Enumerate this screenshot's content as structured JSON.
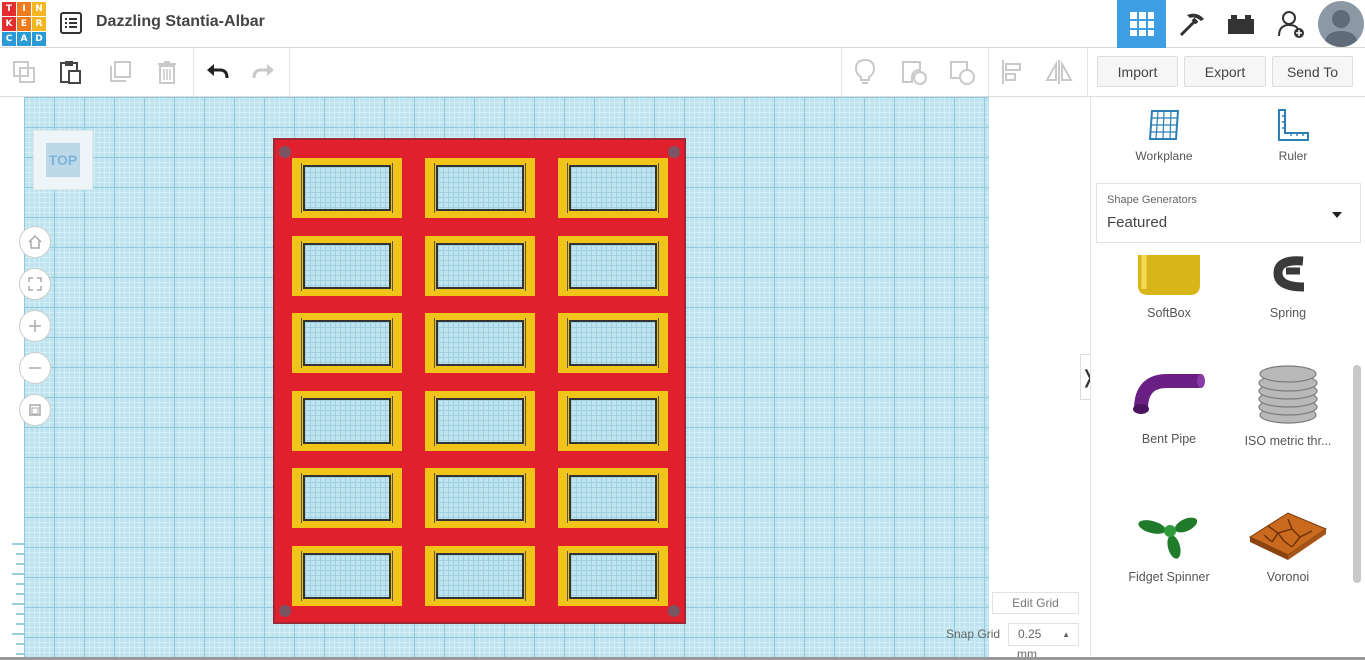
{
  "header": {
    "logo_letters": [
      "T",
      "I",
      "N",
      "K",
      "E",
      "R",
      "C",
      "A",
      "D"
    ],
    "logo_colors": [
      "#e42e2e",
      "#ef7b1c",
      "#f4b622",
      "#e42e2e",
      "#ef7b1c",
      "#f4b622",
      "#2b9bd7",
      "#2b9bd7",
      "#2b9bd7"
    ],
    "design_title": "Dazzling Stantia-Albar",
    "views": [
      {
        "name": "3d-design",
        "icon": "grid-icon",
        "active": true
      },
      {
        "name": "circuits",
        "icon": "pickaxe-icon",
        "active": false
      },
      {
        "name": "codeblocks",
        "icon": "bricks-icon",
        "active": false
      },
      {
        "name": "invite",
        "icon": "add-user-icon",
        "active": false
      }
    ]
  },
  "toolbar": {
    "import_label": "Import",
    "export_label": "Export",
    "send_to_label": "Send To"
  },
  "workplane": {
    "viewcube_label": "TOP",
    "edit_grid_label": "Edit Grid",
    "snap_grid_label": "Snap Grid",
    "snap_grid_value": "0.25",
    "snap_grid_unit": "mm",
    "collapse_glyph": "❭",
    "grid_color": "#bfe4ef",
    "plate_color": "#e0212d",
    "cell_color": "#f0c419",
    "plate_rows": 6,
    "plate_cols": 3
  },
  "panel": {
    "workplane_label": "Workplane",
    "ruler_label": "Ruler",
    "shape_generators_label": "Shape Generators",
    "shape_generators_value": "Featured",
    "shapes": [
      {
        "label": "SoftBox",
        "icon": "softbox-icon"
      },
      {
        "label": "Spring",
        "icon": "spring-icon"
      },
      {
        "label": "Bent Pipe",
        "icon": "bent-pipe-icon"
      },
      {
        "label": "ISO metric thr...",
        "icon": "iso-thread-icon"
      },
      {
        "label": "Fidget Spinner",
        "icon": "fidget-spinner-icon"
      },
      {
        "label": "Voronoi",
        "icon": "voronoi-icon"
      }
    ]
  }
}
